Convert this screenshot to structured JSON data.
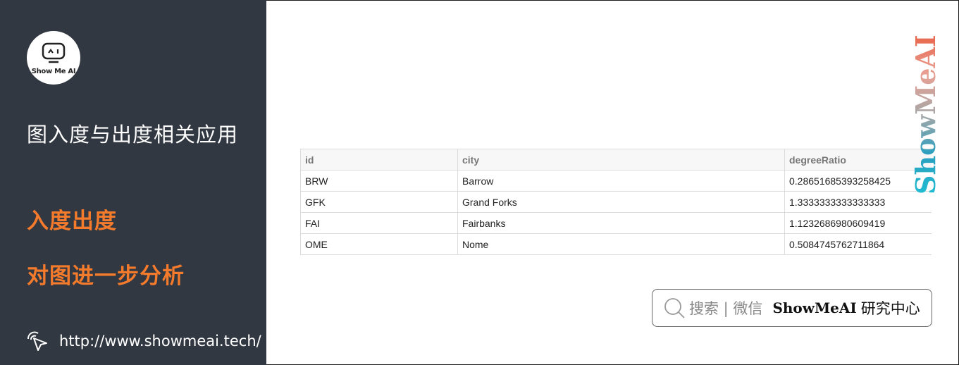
{
  "sidebar": {
    "logo_text": "Show Me AI",
    "title": "图入度与出度相关应用",
    "subtitle_1": "入度出度",
    "subtitle_2": "对图进一步分析",
    "site_url": "http://www.showmeai.tech/"
  },
  "table": {
    "columns": [
      "id",
      "city",
      "degreeRatio"
    ],
    "rows": [
      [
        "BRW",
        "Barrow",
        "0.28651685393258425"
      ],
      [
        "GFK",
        "Grand Forks",
        "1.3333333333333333"
      ],
      [
        "FAI",
        "Fairbanks",
        "1.1232686980609419"
      ],
      [
        "OME",
        "Nome",
        "0.5084745762711864"
      ]
    ]
  },
  "watermark": {
    "text": "ShowMeAI"
  },
  "search_box": {
    "label": "搜索 | 微信",
    "brand": "ShowMeAI",
    "suffix": "研究中心"
  },
  "colors": {
    "sidebar_bg": "#323842",
    "accent_orange": "#f47a2c",
    "brand_cyan": "#1fbcd2"
  }
}
